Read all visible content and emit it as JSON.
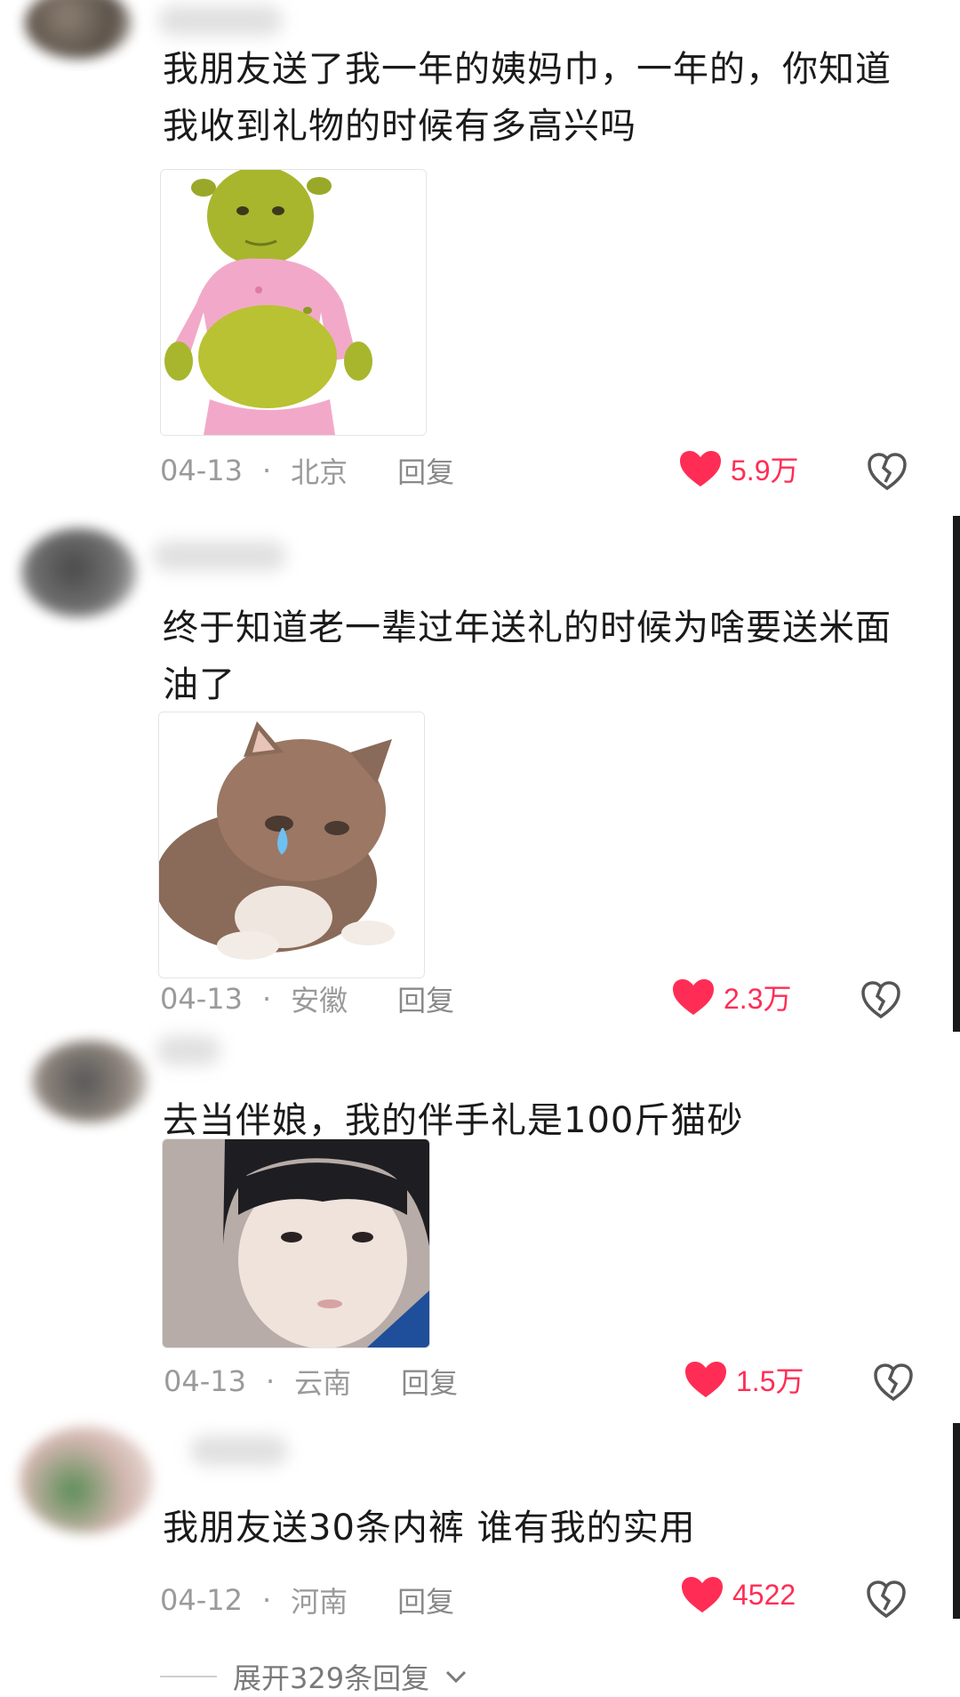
{
  "comments": [
    {
      "text": "我朋友送了我一年的姨妈巾，一年的，你知道我收到礼物的时候有多高兴吗",
      "date": "04-13",
      "location": "北京",
      "reply": "回复",
      "likes": "5.9万",
      "media": "shrek-baby-meme"
    },
    {
      "text": "终于知道老一辈过年送礼的时候为啥要送米面油了",
      "date": "04-13",
      "location": "安徽",
      "reply": "回复",
      "likes": "2.3万",
      "media": "crying-kitten-meme"
    },
    {
      "text": "去当伴娘，我的伴手礼是100斤猫砂",
      "date": "04-13",
      "location": "云南",
      "reply": "回复",
      "likes": "1.5万",
      "media": "girl-portrait-meme"
    },
    {
      "text": "我朋友送30条内裤 谁有我的实用",
      "date": "04-12",
      "location": "河南",
      "reply": "回复",
      "likes": "4522"
    }
  ],
  "expand_label": "展开329条回复",
  "meta_separator": "·",
  "colors": {
    "like": "#ff2d55",
    "meta": "#9a9a9a",
    "text": "#1a1a1a"
  },
  "icons": {
    "like": "heart-icon",
    "dislike": "broken-heart-icon",
    "expand": "chevron-down-icon"
  }
}
